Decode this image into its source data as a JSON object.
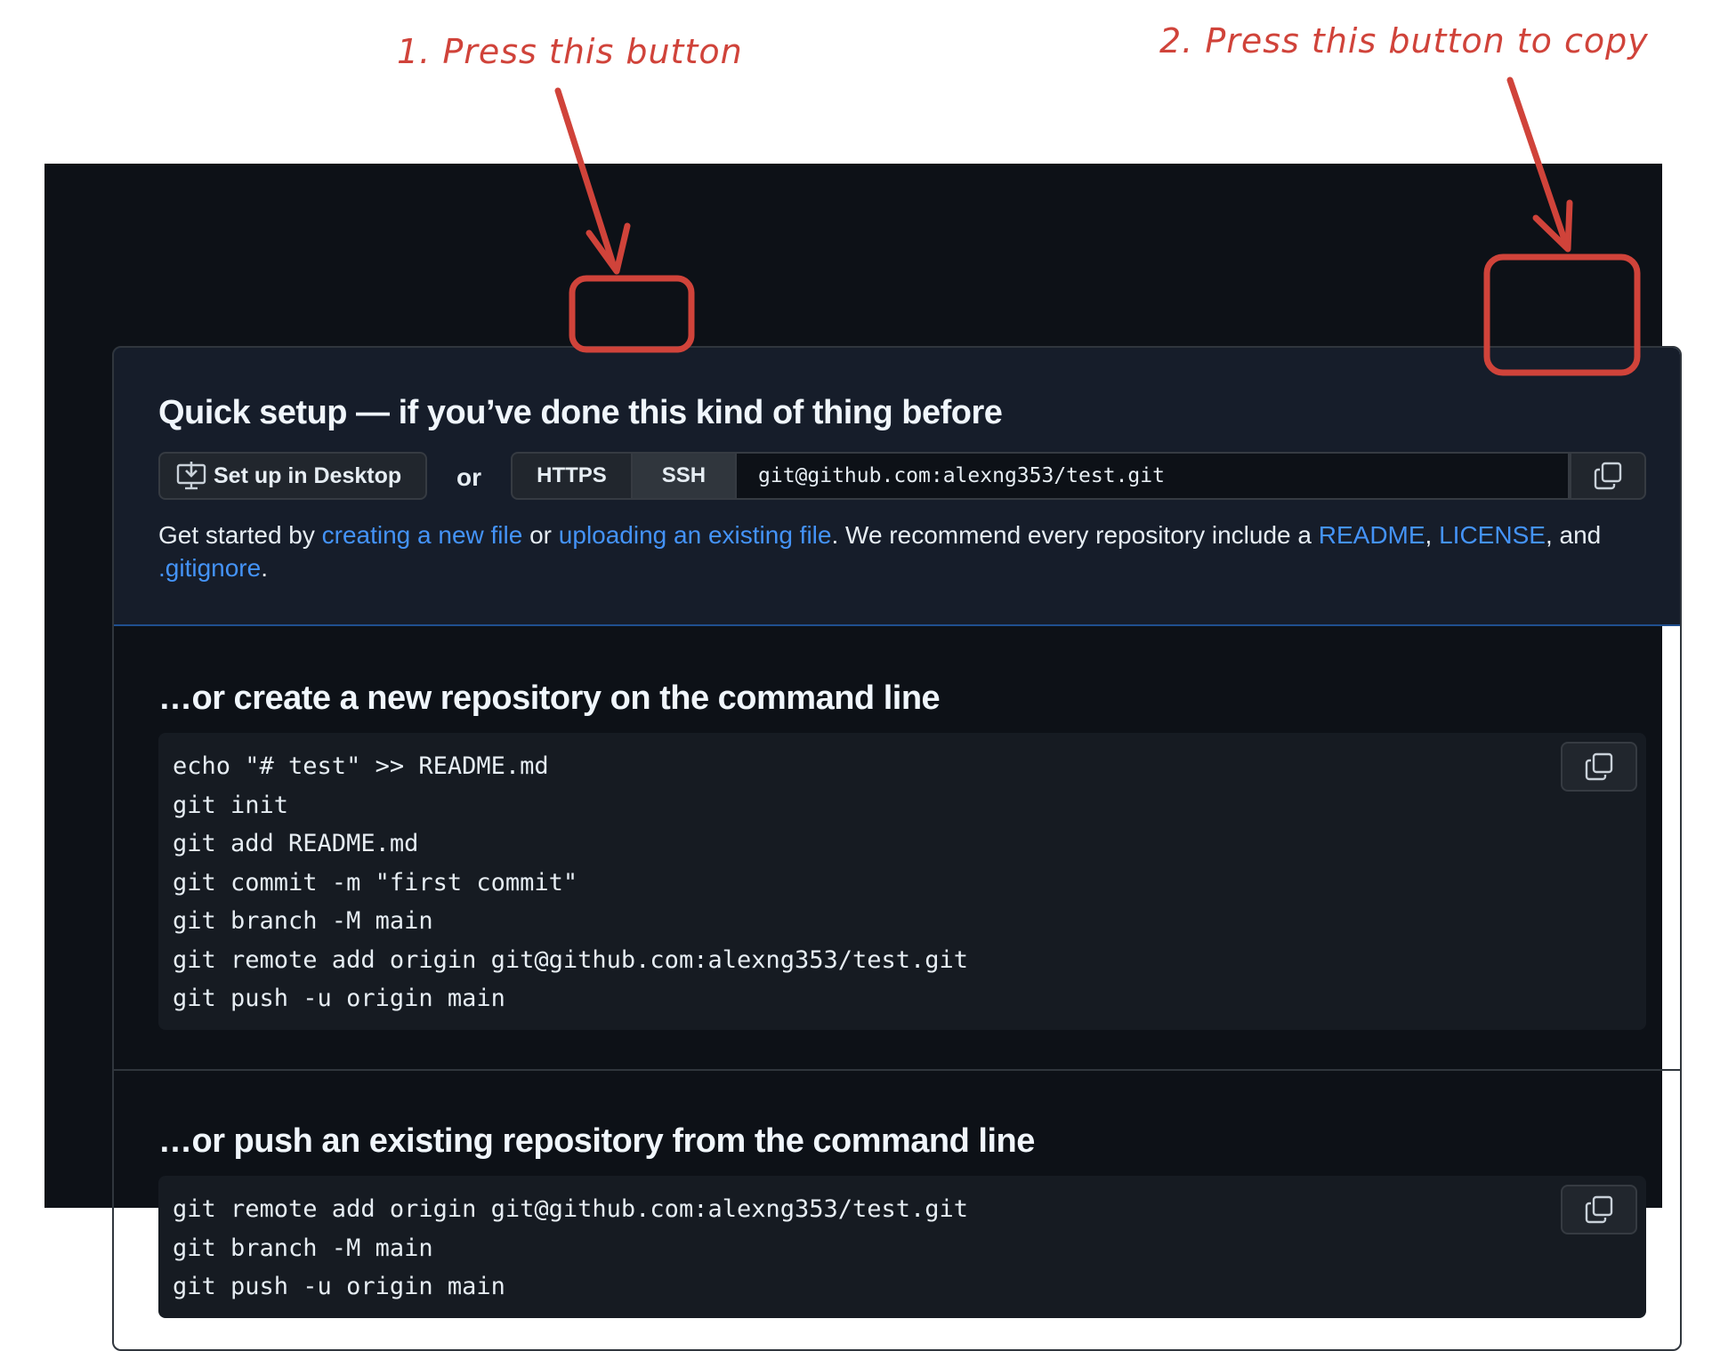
{
  "annotations": {
    "step1": "1. Press this button",
    "step2": "2. Press this button to copy"
  },
  "quick_setup": {
    "title": "Quick setup — if you’ve done this kind of thing before",
    "desktop_button": "Set up in Desktop",
    "or_label": "or",
    "protocols": [
      {
        "label": "HTTPS",
        "selected": false
      },
      {
        "label": "SSH",
        "selected": true
      }
    ],
    "clone_url": "git@github.com:alexng353/test.git",
    "help": {
      "prefix": "Get started by ",
      "link_new_file": "creating a new file",
      "mid1": " or ",
      "link_upload": "uploading an existing file",
      "mid2": ". We recommend every repository include a ",
      "link_readme": "README",
      "comma": ", ",
      "link_license": "LICENSE",
      "mid3": ", and ",
      "link_gitignore": ".gitignore",
      "suffix": "."
    }
  },
  "new_repo": {
    "title": "…or create a new repository on the command line",
    "code": "echo \"# test\" >> README.md\ngit init\ngit add README.md\ngit commit -m \"first commit\"\ngit branch -M main\ngit remote add origin git@github.com:alexng353/test.git\ngit push -u origin main"
  },
  "push_existing": {
    "title": "…or push an existing repository from the command line",
    "code": "git remote add origin git@github.com:alexng353/test.git\ngit branch -M main\ngit push -u origin main"
  },
  "colors": {
    "background": "#0d1117",
    "quick_setup_bg": "#161d2a",
    "link": "#4493f8",
    "annotation": "#d0433a"
  },
  "icons": [
    "desktop-download-icon",
    "copy-icon"
  ]
}
